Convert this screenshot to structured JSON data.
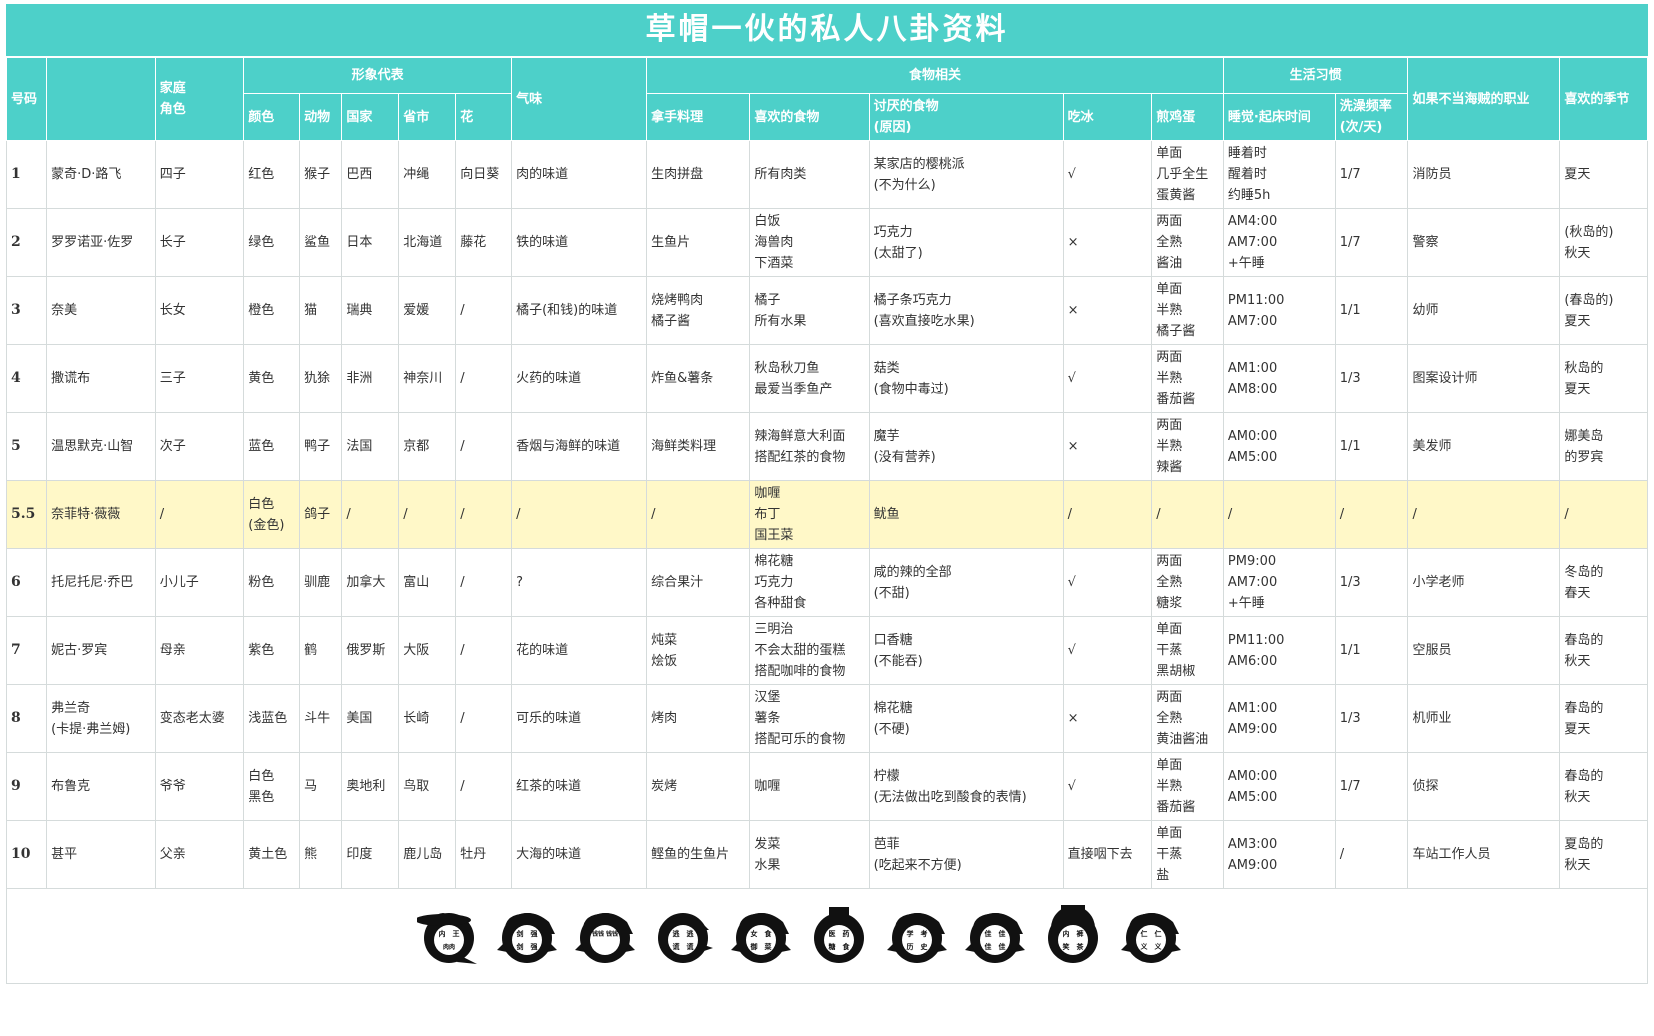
{
  "title": "草帽一伙的私人八卦资料",
  "header_top": {
    "num": "号码",
    "role": "家庭\n角色",
    "image": "形象代表",
    "smell": "气味",
    "food": "食物相关",
    "life": "生活习惯",
    "job": "如果不当海贼的职业",
    "season": "喜欢的季节"
  },
  "header_sub": {
    "color": "颜色",
    "animal": "动物",
    "country": "国家",
    "pref": "省市",
    "flower": "花",
    "signature": "拿手料理",
    "like": "喜欢的食物",
    "dislike": "讨厌的食物\n(原因)",
    "ice": "吃冰",
    "egg": "煎鸡蛋",
    "sleep": "睡觉·起床时间",
    "bath": "洗澡频率\n(次/天)"
  },
  "rows": [
    {
      "num": "1",
      "name": "蒙奇·D·路飞",
      "role": "四子",
      "color": "红色",
      "animal": "猴子",
      "country": "巴西",
      "pref": "冲绳",
      "flower": "向日葵",
      "smell": "肉的味道",
      "signature": "生肉拼盘",
      "like": "所有肉类",
      "dislike": "某家店的樱桃派\n(不为什么)",
      "ice": "√",
      "egg": "单面\n几乎全生\n蛋黄酱",
      "sleep": "睡着时\n醒着时\n约睡5h",
      "bath": "1/7",
      "job": "消防员",
      "season": "夏天"
    },
    {
      "num": "2",
      "name": "罗罗诺亚·佐罗",
      "role": "长子",
      "color": "绿色",
      "animal": "鲨鱼",
      "country": "日本",
      "pref": "北海道",
      "flower": "藤花",
      "smell": "铁的味道",
      "signature": "生鱼片",
      "like": "白饭\n海兽肉\n下酒菜",
      "dislike": "巧克力\n(太甜了)",
      "ice": "×",
      "egg": "两面\n全熟\n酱油",
      "sleep": "AM4:00\nAM7:00\n+午睡",
      "bath": "1/7",
      "job": "警察",
      "season": "(秋岛的)\n秋天"
    },
    {
      "num": "3",
      "name": "奈美",
      "role": "长女",
      "color": "橙色",
      "animal": "猫",
      "country": "瑞典",
      "pref": "爱媛",
      "flower": "/",
      "smell": "橘子(和钱)的味道",
      "signature": "烧烤鸭肉\n橘子酱",
      "like": "橘子\n所有水果",
      "dislike": "橘子条巧克力\n(喜欢直接吃水果)",
      "ice": "×",
      "egg": "单面\n半熟\n橘子酱",
      "sleep": "PM11:00\nAM7:00",
      "bath": "1/1",
      "job": "幼师",
      "season": "(春岛的)\n夏天"
    },
    {
      "num": "4",
      "name": "撒谎布",
      "role": "三子",
      "color": "黄色",
      "animal": "犰狳",
      "country": "非洲",
      "pref": "神奈川",
      "flower": "/",
      "smell": "火药的味道",
      "signature": "炸鱼&薯条",
      "like": "秋岛秋刀鱼\n最爱当季鱼产",
      "dislike": "菇类\n(食物中毒过)",
      "ice": "√",
      "egg": "两面\n半熟\n番茄酱",
      "sleep": "AM1:00\nAM8:00",
      "bath": "1/3",
      "job": "图案设计师",
      "season": "秋岛的\n夏天"
    },
    {
      "num": "5",
      "name": "温思默克·山智",
      "role": "次子",
      "color": "蓝色",
      "animal": "鸭子",
      "country": "法国",
      "pref": "京都",
      "flower": "/",
      "smell": "香烟与海鲜的味道",
      "signature": "海鲜类料理",
      "like": "辣海鲜意大利面\n搭配红茶的食物",
      "dislike": "魔芋\n(没有营养)",
      "ice": "×",
      "egg": "两面\n半熟\n辣酱",
      "sleep": "AM0:00\nAM5:00",
      "bath": "1/1",
      "job": "美发师",
      "season": "娜美岛\n的罗宾"
    },
    {
      "num": "5.5",
      "name": "奈菲特·薇薇",
      "role": "/",
      "color": "白色\n(金色)",
      "animal": "鸽子",
      "country": "/",
      "pref": "/",
      "flower": "/",
      "smell": "/",
      "signature": "/",
      "like": "咖喱\n布丁\n国王菜",
      "dislike": "鱿鱼",
      "ice": "/",
      "egg": "/",
      "sleep": "/",
      "bath": "/",
      "job": "/",
      "season": "/",
      "highlight": true
    },
    {
      "num": "6",
      "name": "托尼托尼·乔巴",
      "role": "小儿子",
      "color": "粉色",
      "animal": "驯鹿",
      "country": "加拿大",
      "pref": "富山",
      "flower": "/",
      "smell": "?",
      "signature": "综合果汁",
      "like": "棉花糖\n巧克力\n各种甜食",
      "dislike": "咸的辣的全部\n(不甜)",
      "ice": "√",
      "egg": "两面\n全熟\n糖浆",
      "sleep": "PM9:00\nAM7:00\n+午睡",
      "bath": "1/3",
      "job": "小学老师",
      "season": "冬岛的\n春天"
    },
    {
      "num": "7",
      "name": "妮古·罗宾",
      "role": "母亲",
      "color": "紫色",
      "animal": "鹤",
      "country": "俄罗斯",
      "pref": "大阪",
      "flower": "/",
      "smell": "花的味道",
      "signature": "炖菜\n烩饭",
      "like": "三明治\n不会太甜的蛋糕\n搭配咖啡的食物",
      "dislike": "口香糖\n(不能吞)",
      "ice": "√",
      "egg": "单面\n干蒸\n黑胡椒",
      "sleep": "PM11:00\nAM6:00",
      "bath": "1/1",
      "job": "空服员",
      "season": "春岛的\n秋天"
    },
    {
      "num": "8",
      "name": "弗兰奇\n(卡提·弗兰姆)",
      "role": "变态老太婆",
      "color": "浅蓝色",
      "animal": "斗牛",
      "country": "美国",
      "pref": "长崎",
      "flower": "/",
      "smell": "可乐的味道",
      "signature": "烤肉",
      "like": "汉堡\n薯条\n搭配可乐的食物",
      "dislike": "棉花糖\n(不硬)",
      "ice": "×",
      "egg": "两面\n全熟\n黄油酱油",
      "sleep": "AM1:00\nAM9:00",
      "bath": "1/3",
      "job": "机师业",
      "season": "春岛的\n夏天"
    },
    {
      "num": "9",
      "name": "布鲁克",
      "role": "爷爷",
      "color": "白色\n黑色",
      "animal": "马",
      "country": "奥地利",
      "pref": "鸟取",
      "flower": "/",
      "smell": "红茶的味道",
      "signature": "炭烤",
      "like": "咖喱",
      "dislike": "柠檬\n(无法做出吃到酸食的表情)",
      "ice": "√",
      "egg": "单面\n半熟\n番茄酱",
      "sleep": "AM0:00\nAM5:00",
      "bath": "1/7",
      "job": "侦探",
      "season": "春岛的\n秋天"
    },
    {
      "num": "10",
      "name": "甚平",
      "role": "父亲",
      "color": "黄土色",
      "animal": "熊",
      "country": "印度",
      "pref": "鹿儿岛",
      "flower": "牡丹",
      "smell": "大海的味道",
      "signature": "鲣鱼的生鱼片",
      "like": "发菜\n水果",
      "dislike": "芭菲\n(吃起来不方便)",
      "ice": "直接咽下去",
      "egg": "单面\n干蒸\n盐",
      "sleep": "AM3:00\nAM9:00",
      "bath": "/",
      "job": "车站工作人员",
      "season": "夏岛的\n秋天"
    }
  ],
  "emblems": [
    {
      "name": "luffy-emblem-icon",
      "text": [
        "内",
        "王",
        "肉肉"
      ],
      "hat": "straw"
    },
    {
      "name": "zoro-emblem-icon",
      "text": [
        "剑",
        "强",
        "剑",
        "强"
      ],
      "hat": "none"
    },
    {
      "name": "nami-emblem-icon",
      "text": [
        "钱钱",
        "钱钱"
      ],
      "hat": "none"
    },
    {
      "name": "usopp-emblem-icon",
      "text": [
        "逃",
        "逃",
        "谎",
        "谎"
      ],
      "hat": "cap"
    },
    {
      "name": "sanji-emblem-icon",
      "text": [
        "女",
        "食",
        "御",
        "菜"
      ],
      "hat": "none"
    },
    {
      "name": "chopper-emblem-icon",
      "text": [
        "医",
        "药",
        "糖",
        "食"
      ],
      "hat": "top"
    },
    {
      "name": "robin-emblem-icon",
      "text": [
        "学",
        "考",
        "历",
        "史"
      ],
      "hat": "none"
    },
    {
      "name": "franky-emblem-icon",
      "text": [
        "佳",
        "佳",
        "佳",
        "佳"
      ],
      "hat": "none"
    },
    {
      "name": "brook-emblem-icon",
      "text": [
        "内",
        "裤",
        "笑",
        "茶"
      ],
      "hat": "afro"
    },
    {
      "name": "jinbe-emblem-icon",
      "text": [
        "仁",
        "仁",
        "义",
        "义"
      ],
      "hat": "none"
    }
  ]
}
